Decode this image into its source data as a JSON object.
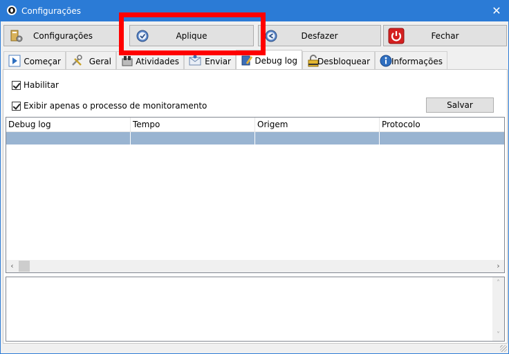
{
  "window": {
    "title": "Configurações",
    "close_glyph": "✕"
  },
  "toolbar": {
    "buttons": [
      {
        "label": "Configurações",
        "icon": "settings-book-icon"
      },
      {
        "label": "Aplique",
        "icon": "check-clock-icon"
      },
      {
        "label": "Desfazer",
        "icon": "undo-icon"
      },
      {
        "label": "Fechar",
        "icon": "power-icon"
      }
    ]
  },
  "tabs": [
    {
      "label": "Começar",
      "icon": "play-icon"
    },
    {
      "label": "Geral",
      "icon": "tools-icon"
    },
    {
      "label": "Atividades",
      "icon": "activities-icon"
    },
    {
      "label": "Enviar",
      "icon": "send-mail-icon"
    },
    {
      "label": "Debug log",
      "icon": "pencil-book-icon",
      "active": true
    },
    {
      "label": "Desbloquear",
      "icon": "lock-icon"
    },
    {
      "label": "Informações",
      "icon": "info-icon"
    }
  ],
  "options": {
    "enable": {
      "label": "Habilitar",
      "checked": true
    },
    "monitor_only": {
      "label": "Exibir apenas o processo de monitoramento",
      "checked": true
    },
    "save_label": "Salvar"
  },
  "log_table": {
    "columns": [
      "Debug log",
      "Tempo",
      "Origem",
      "Protocolo"
    ],
    "rows": [
      [
        "",
        "",
        "",
        ""
      ]
    ],
    "scroll_left": "‹",
    "scroll_right": "›"
  },
  "details": {
    "value": "",
    "scroll_up": "˄",
    "scroll_down": "˅"
  }
}
